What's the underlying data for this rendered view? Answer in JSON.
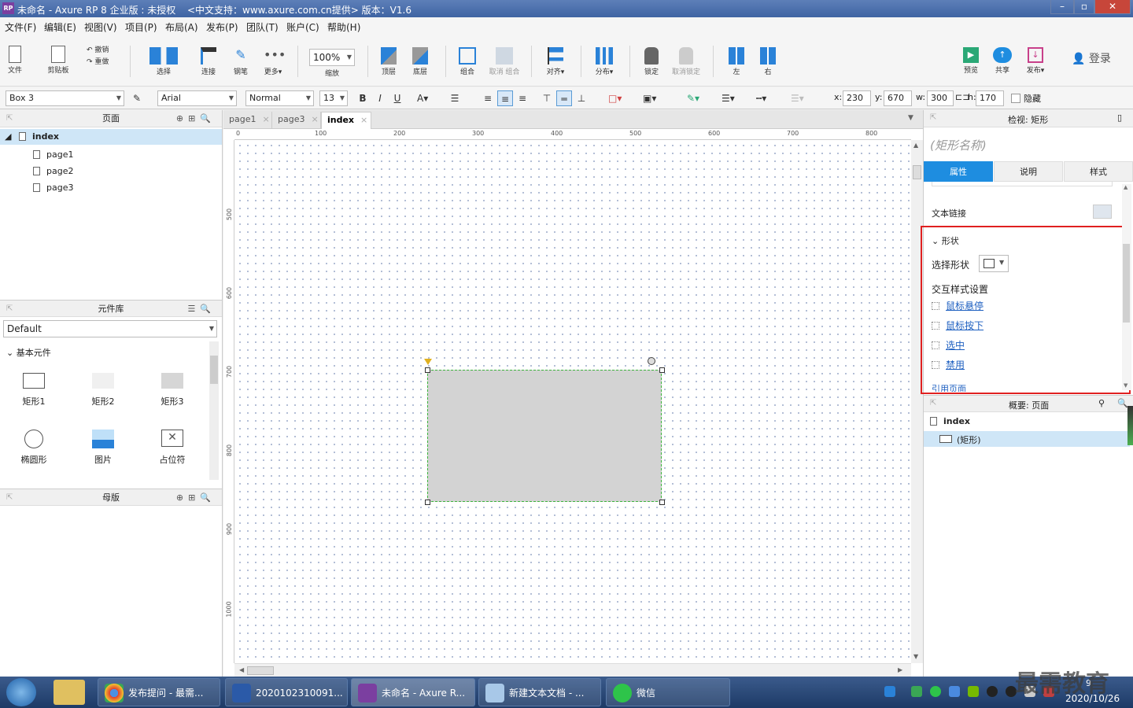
{
  "window": {
    "title": "未命名 - Axure RP 8 企业版 : 未授权",
    "subtitle": "<中文支持：www.axure.com.cn提供> 版本：V1.6",
    "app_icon_text": "RP"
  },
  "menu": [
    "文件(F)",
    "编辑(E)",
    "视图(V)",
    "项目(P)",
    "布局(A)",
    "发布(P)",
    "团队(T)",
    "账户(C)",
    "帮助(H)"
  ],
  "toolbar": {
    "file": "文件",
    "clipboard": "剪贴板",
    "undo": "撤销",
    "redo": "重做",
    "select": "选择",
    "connect": "连接",
    "pen": "钢笔",
    "more": "更多▾",
    "zoom_value": "100%",
    "zoom": "缩放",
    "front": "顶层",
    "back": "底层",
    "group": "组合",
    "ungroup": "取消 组合",
    "align": "对齐▾",
    "distribute": "分布▾",
    "lock": "锁定",
    "unlock": "取消锁定",
    "left": "左",
    "right": "右",
    "preview": "预览",
    "share": "共享",
    "publish": "发布▾",
    "login": "登录"
  },
  "format": {
    "widget_name": "Box 3",
    "font": "Arial",
    "style": "Normal",
    "size": "13",
    "x_label": "x:",
    "x": "230",
    "y_label": "y:",
    "y": "670",
    "w_label": "w:",
    "w": "300",
    "h_label": "h:",
    "h": "170",
    "hidden": "隐藏"
  },
  "pages": {
    "header": "页面",
    "root": "index",
    "children": [
      "page1",
      "page2",
      "page3"
    ]
  },
  "library": {
    "header": "元件库",
    "selected": "Default",
    "group": "基本元件",
    "items": [
      "矩形1",
      "矩形2",
      "矩形3",
      "椭圆形",
      "图片",
      "占位符"
    ]
  },
  "masters": {
    "header": "母版"
  },
  "tabs": [
    {
      "label": "page1",
      "close": "×"
    },
    {
      "label": "page3",
      "close": "×"
    },
    {
      "label": "index",
      "close": "×"
    }
  ],
  "ruler": {
    "h": [
      "0",
      "100",
      "200",
      "300",
      "400",
      "500",
      "600",
      "700",
      "800"
    ],
    "v": [
      "500",
      "600",
      "700",
      "800",
      "900",
      "1000"
    ]
  },
  "inspector": {
    "header": "检视: 矩形",
    "name_placeholder": "(矩形名称)",
    "tabs": [
      "属性",
      "说明",
      "样式"
    ],
    "text_link": "文本链接",
    "shape_section": "形状",
    "select_shape": "选择形状",
    "interaction_styles": "交互样式设置",
    "links": [
      "鼠标悬停",
      "鼠标按下",
      "选中",
      "禁用"
    ],
    "ref_page": "引用页面"
  },
  "outline": {
    "header": "概要: 页面",
    "root": "index",
    "child": "(矩形)"
  },
  "taskbar": {
    "items": [
      "发布提问 - 最需...",
      "2020102310091...",
      "未命名 - Axure R...",
      "新建文本文档 - ...",
      "微信"
    ],
    "date": "2020/10/26",
    "time": "9",
    "watermark": "最需教育"
  },
  "colors": {
    "accent": "#1e8de0",
    "highlight_box": "#e02020",
    "selection": "#3cb43c",
    "rect_fill": "#d3d3d3"
  }
}
